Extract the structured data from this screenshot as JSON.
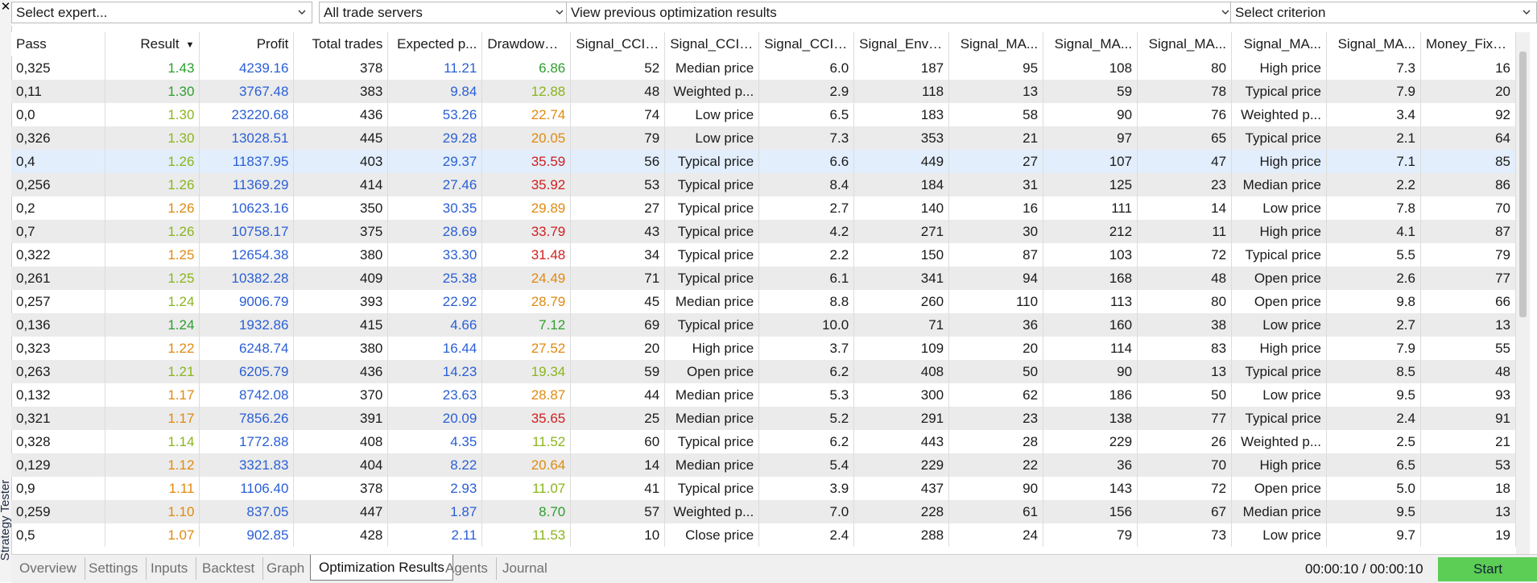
{
  "side_panel": {
    "title": "Strategy Tester",
    "close_glyph": "✕"
  },
  "toolbar": {
    "expert_select": "Select expert...",
    "server_select": "All trade servers",
    "results_select": "View previous optimization results",
    "criterion_select": "Select criterion"
  },
  "table": {
    "columns": [
      "Pass",
      "Result",
      "Profit",
      "Total trades",
      "Expected p...",
      "Drawdown ...",
      "Signal_CCI_...",
      "Signal_CCI_...",
      "Signal_CCI_...",
      "Signal_Enve...",
      "Signal_MA...",
      "Signal_MA...",
      "Signal_MA...",
      "Signal_MA...",
      "Signal_MA...",
      "Money_FixM..."
    ],
    "sorted_column": "Result",
    "rows": [
      [
        "0,325",
        "1.43",
        "4239.16",
        "378",
        "11.21",
        "6.86",
        "52",
        "Median price",
        "6.0",
        "187",
        "95",
        "108",
        "80",
        "High price",
        "7.3",
        "16"
      ],
      [
        "0,11",
        "1.30",
        "3767.48",
        "383",
        "9.84",
        "12.88",
        "48",
        "Weighted p...",
        "2.9",
        "118",
        "13",
        "59",
        "78",
        "Typical price",
        "7.9",
        "20"
      ],
      [
        "0,0",
        "1.30",
        "23220.68",
        "436",
        "53.26",
        "22.74",
        "74",
        "Low price",
        "6.5",
        "183",
        "58",
        "90",
        "76",
        "Weighted p...",
        "3.4",
        "92"
      ],
      [
        "0,326",
        "1.30",
        "13028.51",
        "445",
        "29.28",
        "20.05",
        "79",
        "Low price",
        "7.3",
        "353",
        "21",
        "97",
        "65",
        "Typical price",
        "2.1",
        "64"
      ],
      [
        "0,4",
        "1.26",
        "11837.95",
        "403",
        "29.37",
        "35.59",
        "56",
        "Typical price",
        "6.6",
        "449",
        "27",
        "107",
        "47",
        "High price",
        "7.1",
        "85"
      ],
      [
        "0,256",
        "1.26",
        "11369.29",
        "414",
        "27.46",
        "35.92",
        "53",
        "Typical price",
        "8.4",
        "184",
        "31",
        "125",
        "23",
        "Median price",
        "2.2",
        "86"
      ],
      [
        "0,2",
        "1.26",
        "10623.16",
        "350",
        "30.35",
        "29.89",
        "27",
        "Typical price",
        "2.7",
        "140",
        "16",
        "111",
        "14",
        "Low price",
        "7.8",
        "70"
      ],
      [
        "0,7",
        "1.26",
        "10758.17",
        "375",
        "28.69",
        "33.79",
        "43",
        "Typical price",
        "4.2",
        "271",
        "30",
        "212",
        "11",
        "High price",
        "4.1",
        "87"
      ],
      [
        "0,322",
        "1.25",
        "12654.38",
        "380",
        "33.30",
        "31.48",
        "34",
        "Typical price",
        "2.2",
        "150",
        "87",
        "103",
        "72",
        "Typical price",
        "5.5",
        "79"
      ],
      [
        "0,261",
        "1.25",
        "10382.28",
        "409",
        "25.38",
        "24.49",
        "71",
        "Typical price",
        "6.1",
        "341",
        "94",
        "168",
        "48",
        "Open price",
        "2.6",
        "77"
      ],
      [
        "0,257",
        "1.24",
        "9006.79",
        "393",
        "22.92",
        "28.79",
        "45",
        "Median price",
        "8.8",
        "260",
        "110",
        "113",
        "80",
        "Open price",
        "9.8",
        "66"
      ],
      [
        "0,136",
        "1.24",
        "1932.86",
        "415",
        "4.66",
        "7.12",
        "69",
        "Typical price",
        "10.0",
        "71",
        "36",
        "160",
        "38",
        "Low price",
        "2.7",
        "13"
      ],
      [
        "0,323",
        "1.22",
        "6248.74",
        "380",
        "16.44",
        "27.52",
        "20",
        "High price",
        "3.7",
        "109",
        "20",
        "114",
        "83",
        "High price",
        "7.9",
        "55"
      ],
      [
        "0,263",
        "1.21",
        "6205.79",
        "436",
        "14.23",
        "19.34",
        "59",
        "Open price",
        "6.2",
        "408",
        "50",
        "90",
        "13",
        "Typical price",
        "8.5",
        "48"
      ],
      [
        "0,132",
        "1.17",
        "8742.08",
        "370",
        "23.63",
        "28.87",
        "44",
        "Median price",
        "5.3",
        "300",
        "62",
        "186",
        "50",
        "Low price",
        "9.5",
        "93"
      ],
      [
        "0,321",
        "1.17",
        "7856.26",
        "391",
        "20.09",
        "35.65",
        "25",
        "Median price",
        "5.2",
        "291",
        "23",
        "138",
        "77",
        "Typical price",
        "2.4",
        "91"
      ],
      [
        "0,328",
        "1.14",
        "1772.88",
        "408",
        "4.35",
        "11.52",
        "60",
        "Typical price",
        "6.2",
        "443",
        "28",
        "229",
        "26",
        "Weighted p...",
        "2.5",
        "21"
      ],
      [
        "0,129",
        "1.12",
        "3321.83",
        "404",
        "8.22",
        "20.64",
        "14",
        "Median price",
        "5.4",
        "229",
        "22",
        "36",
        "70",
        "High price",
        "6.5",
        "53"
      ],
      [
        "0,9",
        "1.11",
        "1106.40",
        "378",
        "2.93",
        "11.07",
        "41",
        "Typical price",
        "3.9",
        "437",
        "90",
        "143",
        "72",
        "Open price",
        "5.0",
        "18"
      ],
      [
        "0,259",
        "1.10",
        "837.05",
        "447",
        "1.87",
        "8.70",
        "57",
        "Weighted p...",
        "7.0",
        "228",
        "61",
        "156",
        "67",
        "Median price",
        "9.5",
        "13"
      ],
      [
        "0,5",
        "1.07",
        "902.85",
        "428",
        "2.11",
        "11.53",
        "10",
        "Close price",
        "2.4",
        "288",
        "24",
        "79",
        "73",
        "Low price",
        "9.7",
        "19"
      ]
    ],
    "selected_row": 4,
    "result_colors": [
      "#2e9e2e",
      "#2e9e2e",
      "#8ab51c",
      "#8ab51c",
      "#8ab51c",
      "#8ab51c",
      "#e08a10",
      "#8ab51c",
      "#e08a10",
      "#8ab51c",
      "#8ab51c",
      "#2e9e2e",
      "#e08a10",
      "#8ab51c",
      "#e08a10",
      "#e08a10",
      "#8ab51c",
      "#e08a10",
      "#e08a10",
      "#e08a10",
      "#e08a10"
    ],
    "drawdown_colors": [
      "#2e9e2e",
      "#8ab51c",
      "#e08a10",
      "#e08a10",
      "#d02020",
      "#d02020",
      "#e08a10",
      "#d02020",
      "#d02020",
      "#e08a10",
      "#e08a10",
      "#2e9e2e",
      "#e08a10",
      "#8ab51c",
      "#e08a10",
      "#d02020",
      "#8ab51c",
      "#e08a10",
      "#8ab51c",
      "#2e9e2e",
      "#8ab51c"
    ],
    "profit_color": "#2a5fd6",
    "expected_color": "#2a5fd6"
  },
  "bottom": {
    "tabs": [
      "Overview",
      "Settings",
      "Inputs",
      "Backtest",
      "Graph",
      "Optimization Results",
      "Agents",
      "Journal"
    ],
    "active_tab": "Optimization Results",
    "timer": "00:00:10 / 00:00:10",
    "start_label": "Start",
    "start_color": "#5ccd55"
  }
}
